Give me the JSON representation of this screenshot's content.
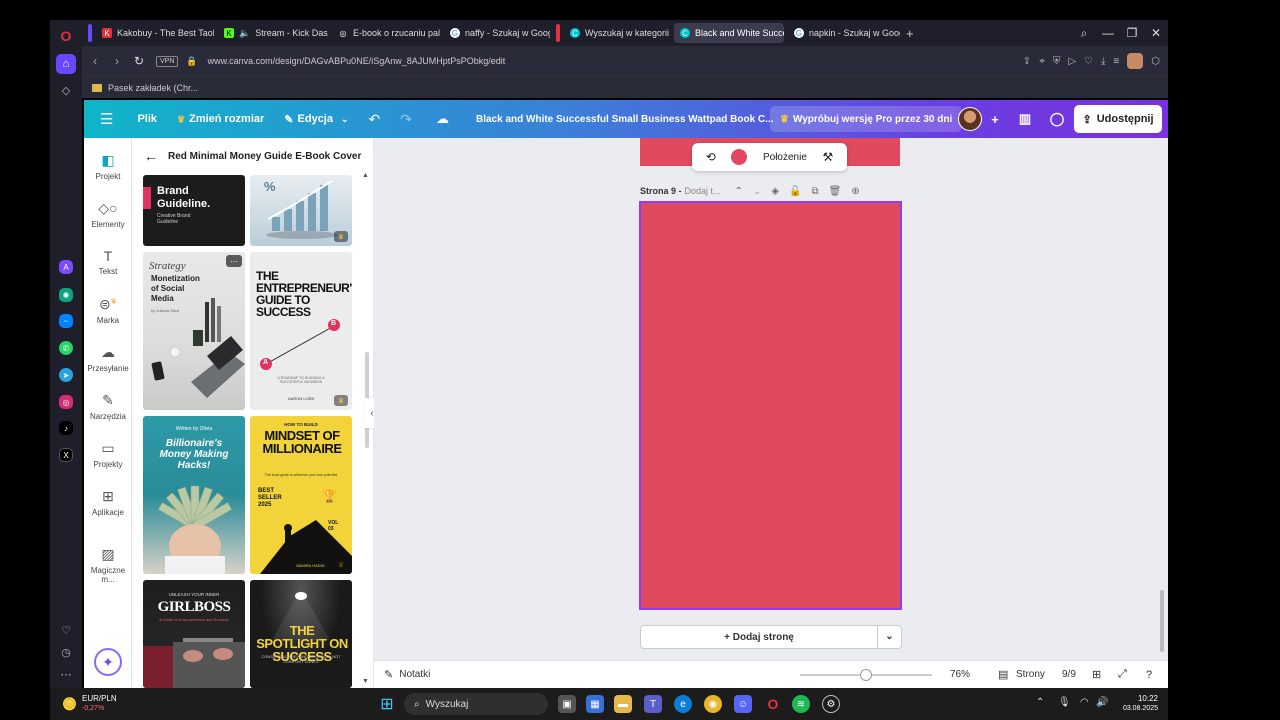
{
  "browser": {
    "tabs": [
      {
        "label": "Kakobuy - The Best Taoba",
        "color": "#e0323d",
        "glyph": "K"
      },
      {
        "label": "Stream - Kick Dashbo",
        "color": "#53fc18",
        "glyph": "K"
      },
      {
        "label": "E-book o rzucaniu palenia",
        "color": "#ffffff",
        "glyph": "◎"
      },
      {
        "label": "naffy - Szukaj w Google",
        "color": "#4285f4",
        "glyph": "G"
      },
      {
        "label": "Wyszukaj w kategorii e-bo",
        "color": "#00c4cc",
        "glyph": "C"
      },
      {
        "label": "Black and White Successfu",
        "color": "#00c4cc",
        "glyph": "C"
      },
      {
        "label": "napkin - Szukaj w Google",
        "color": "#4285f4",
        "glyph": "G"
      }
    ],
    "url": "www.canva.com/design/DAGvABPu0NE/iSgAnw_8AJUMHptPsPObkg/edit",
    "vpn_label": "VPN",
    "bookmark": "Pasek zakładek (Chr..."
  },
  "canva": {
    "menu": {
      "file": "Plik",
      "resize": "Zmień rozmiar",
      "edit": "Edycja"
    },
    "doc_title": "Black and White Successful Small Business Wattpad Book C...",
    "pro_trial": "Wypróbuj wersję Pro przez 30 dni",
    "share": "Udostępnij",
    "sidebar": [
      {
        "label": "Projekt",
        "icon": "layout-icon"
      },
      {
        "label": "Elementy",
        "icon": "shapes-icon"
      },
      {
        "label": "Tekst",
        "icon": "text-icon"
      },
      {
        "label": "Marka",
        "icon": "brand-icon"
      },
      {
        "label": "Przesyłanie",
        "icon": "upload-cloud-icon"
      },
      {
        "label": "Narzędzia",
        "icon": "tools-icon"
      },
      {
        "label": "Projekty",
        "icon": "folder-icon"
      },
      {
        "label": "Aplikacje",
        "icon": "apps-icon"
      },
      {
        "label": "Magiczne m...",
        "icon": "magic-media-icon"
      }
    ],
    "panel": {
      "title": "Red Minimal Money Guide E-Book Cover",
      "templates": {
        "brand_guideline": {
          "title": "Brand Guideline.",
          "sub1": "Creative Brand",
          "sub2": "Guideline"
        },
        "strategy": {
          "script": "Strategy",
          "title": "Monetization of Social Media",
          "author": "by Juliana Silva"
        },
        "entrepreneur": {
          "title": "THE ENTREPRENEUR'S GUIDE TO SUCCESS",
          "a": "A",
          "b": "B",
          "sub": "A ROADMAP TO BUILDING A SUCCESSFUL BUSINESS",
          "author": "AARON LOEB"
        },
        "billionaire": {
          "byline": "Written by Olivia",
          "title": "Billionaire's Money Making Hacks!"
        },
        "mindset": {
          "kicker": "HOW TO BUILD",
          "title": "MINDSET OF MILLIONAIRE",
          "tagline": "The book guide to wherever your true potential",
          "badge": "BEST SELLER 2025",
          "vol": "VOL 03",
          "author": "SAMIRA HADID"
        },
        "girlboss": {
          "kicker": "UNLEASH YOUR INNER",
          "title": "GIRLBOSS",
          "sub": "A Guide to Empowerment and Success"
        },
        "spotlight": {
          "title": "THE SPOTLIGHT ON SUCCESS",
          "sub": "CONSISTENCY BEYOND BOREDOM, NOT COMFORT ZONES"
        }
      }
    },
    "ctx_toolbar": {
      "position": "Położenie",
      "fill_color": "#e14a5e"
    },
    "page": {
      "label": "Strona 9 -",
      "title_placeholder": "Dodaj t...",
      "color": "#e14a5e"
    },
    "add_page": "+ Dodaj stronę",
    "bottom": {
      "notes": "Notatki",
      "zoom": "76%",
      "pages_label": "Strony",
      "page_counter": "9/9",
      "zoom_fraction": 0.5
    }
  },
  "taskbar": {
    "currency": "EUR/PLN",
    "change": "-0,27%",
    "search": "Wyszukaj",
    "time": "10:22",
    "date": "03.08.2025"
  }
}
